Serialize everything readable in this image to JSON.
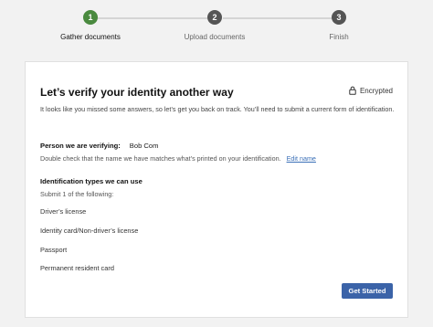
{
  "stepper": {
    "steps": [
      {
        "number": "1",
        "label": "Gather documents",
        "state": "active"
      },
      {
        "number": "2",
        "label": "Upload documents",
        "state": "upcoming"
      },
      {
        "number": "3",
        "label": "Finish",
        "state": "upcoming"
      }
    ],
    "colors": {
      "active": "#4a8a3f",
      "upcoming": "#555555",
      "active_text": "#111111",
      "upcoming_text": "#666666"
    }
  },
  "card": {
    "title": "Let’s verify your identity another way",
    "encrypted_label": "Encrypted",
    "intro": "It looks like you missed some answers, so let’s get you back on track. You’ll need to submit a current form of identification.",
    "person_label": "Person we are verifying:",
    "person_name": "Bob Com",
    "double_check": "Double check that the name we have matches what’s printed on your identification.",
    "edit_link": "Edit name",
    "id_types_title": "Identification types we can use",
    "submit_note": "Submit 1 of the following:",
    "id_types": [
      "Driver’s license",
      "Identity card/Non-driver’s license",
      "Passport",
      "Permanent resident card"
    ],
    "button_label": "Get Started"
  }
}
